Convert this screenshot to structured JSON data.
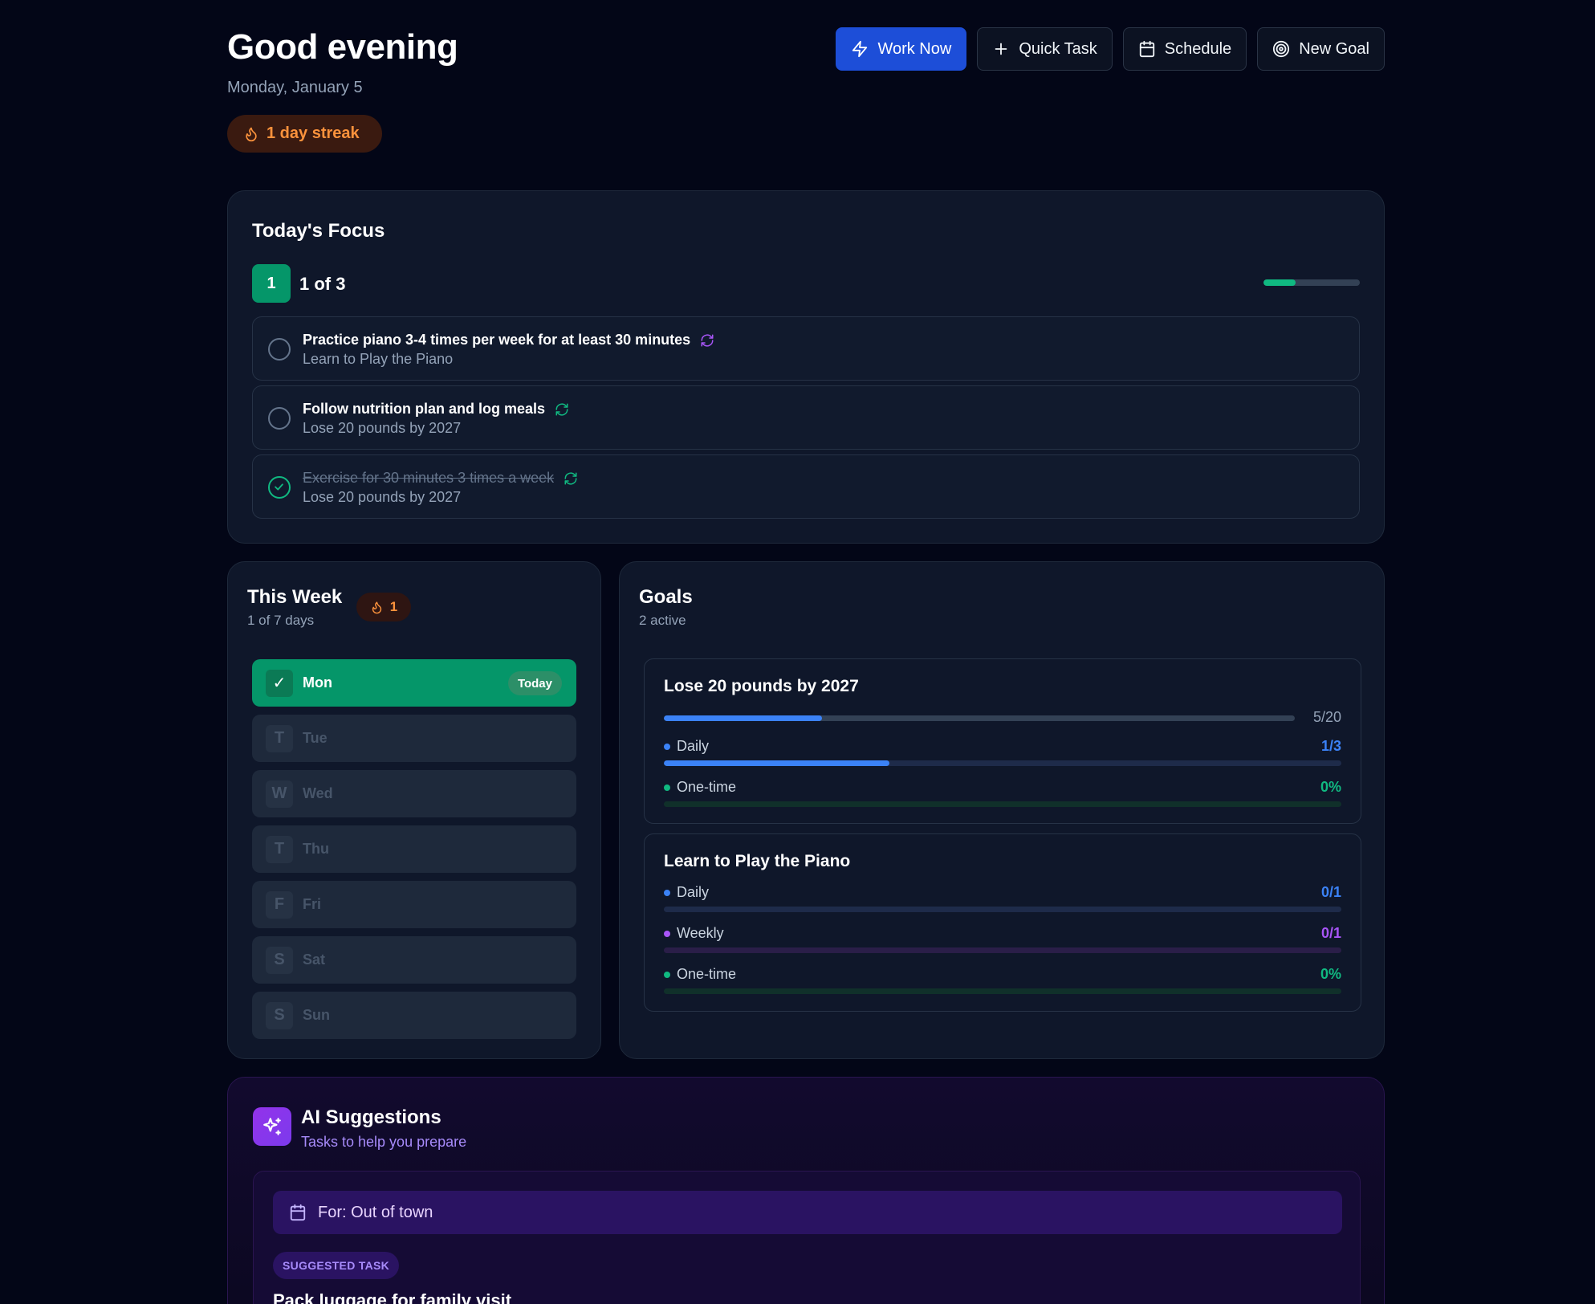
{
  "header": {
    "greeting": "Good evening",
    "date": "Monday, January 5",
    "streak": "1 day streak"
  },
  "actions": {
    "work_now": "Work Now",
    "quick_task": "Quick Task",
    "schedule": "Schedule",
    "new_goal": "New Goal"
  },
  "focus": {
    "title": "Today's Focus",
    "completed_count": "1",
    "progress_text": "1 of 3",
    "progress_fraction": 0.3333,
    "tasks": [
      {
        "title": "Practice piano 3-4 times per week for at least 30 minutes",
        "goal": "Learn to Play the Piano",
        "done": false,
        "repeat_color": "#a855f7"
      },
      {
        "title": "Follow nutrition plan and log meals",
        "goal": "Lose 20 pounds by 2027",
        "done": false,
        "repeat_color": "#10b981"
      },
      {
        "title": "Exercise for 30 minutes 3 times a week",
        "goal": "Lose 20 pounds by 2027",
        "done": true,
        "repeat_color": "#10b981"
      }
    ]
  },
  "week": {
    "title": "This Week",
    "subtitle": "1 of 7 days",
    "streak_count": "1",
    "today_label": "Today",
    "days": [
      {
        "letter": "✓",
        "name": "Mon",
        "today": true
      },
      {
        "letter": "T",
        "name": "Tue",
        "today": false
      },
      {
        "letter": "W",
        "name": "Wed",
        "today": false
      },
      {
        "letter": "T",
        "name": "Thu",
        "today": false
      },
      {
        "letter": "F",
        "name": "Fri",
        "today": false
      },
      {
        "letter": "S",
        "name": "Sat",
        "today": false
      },
      {
        "letter": "S",
        "name": "Sun",
        "today": false
      }
    ]
  },
  "goals": {
    "title": "Goals",
    "subtitle": "2 active",
    "items": [
      {
        "title": "Lose 20 pounds by 2027",
        "total": "5/20",
        "total_fraction": 0.25,
        "rows": [
          {
            "label": "Daily",
            "value": "1/3",
            "fraction": 0.3333,
            "color": "#3b82f6",
            "track": "#1e2b4a"
          },
          {
            "label": "One-time",
            "value": "0%",
            "fraction": 0,
            "color": "#10b981",
            "track": "#10302a"
          }
        ]
      },
      {
        "title": "Learn to Play the Piano",
        "rows": [
          {
            "label": "Daily",
            "value": "0/1",
            "fraction": 0,
            "color": "#3b82f6",
            "track": "#1e2b4a"
          },
          {
            "label": "Weekly",
            "value": "0/1",
            "fraction": 0,
            "color": "#a855f7",
            "track": "#2a1e48"
          },
          {
            "label": "One-time",
            "value": "0%",
            "fraction": 0,
            "color": "#10b981",
            "track": "#10302a"
          }
        ]
      }
    ]
  },
  "ai": {
    "title": "AI Suggestions",
    "subtitle": "Tasks to help you prepare",
    "for_label": "For: Out of town",
    "tag": "SUGGESTED TASK",
    "task_title": "Pack luggage for family visit"
  },
  "colors": {
    "background": "#030617",
    "primary": "#1d4ed8",
    "success": "#059669",
    "streak": "#fb923c",
    "ai_accent": "#a78bfa"
  }
}
